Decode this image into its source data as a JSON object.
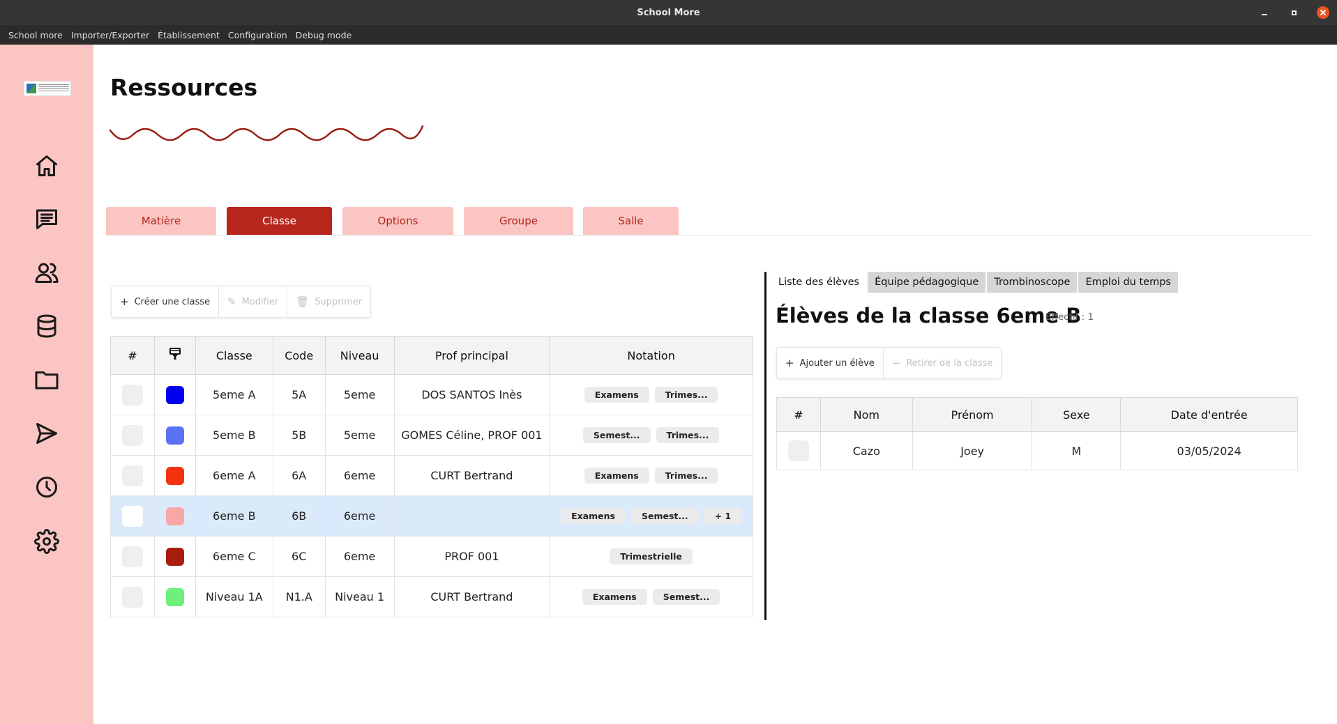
{
  "window": {
    "title": "School More"
  },
  "menu": [
    "School more",
    "Importer/Exporter",
    "Établissement",
    "Configuration",
    "Debug mode"
  ],
  "sidebar": {
    "icons": [
      "home-icon",
      "chat-icon",
      "users-icon",
      "database-icon",
      "folder-icon",
      "send-icon",
      "clock-icon",
      "gear-icon"
    ]
  },
  "page": {
    "title": "Ressources"
  },
  "tabs": [
    {
      "label": "Matière",
      "active": false
    },
    {
      "label": "Classe",
      "active": true
    },
    {
      "label": "Options",
      "active": false
    },
    {
      "label": "Groupe",
      "active": false
    },
    {
      "label": "Salle",
      "active": false
    }
  ],
  "toolbar": {
    "create": "Créer une classe",
    "edit": "Modifier",
    "delete": "Supprimer"
  },
  "class_table": {
    "headers": [
      "#",
      "",
      "Classe",
      "Code",
      "Niveau",
      "Prof principal",
      "Notation"
    ],
    "rows": [
      {
        "color": "#0000ee",
        "classe": "5eme A",
        "code": "5A",
        "niveau": "5eme",
        "prof": "DOS SANTOS Inès",
        "notation": [
          "Examens",
          "Trimes..."
        ],
        "selected": false
      },
      {
        "color": "#5b72f2",
        "classe": "5eme B",
        "code": "5B",
        "niveau": "5eme",
        "prof": "GOMES Céline, PROF 001",
        "notation": [
          "Semest...",
          "Trimes..."
        ],
        "selected": false
      },
      {
        "color": "#f2330f",
        "classe": "6eme A",
        "code": "6A",
        "niveau": "6eme",
        "prof": "CURT Bertrand",
        "notation": [
          "Examens",
          "Trimes..."
        ],
        "selected": false
      },
      {
        "color": "#f7a8a6",
        "classe": "6eme B",
        "code": "6B",
        "niveau": "6eme",
        "prof": "",
        "notation": [
          "Examens",
          "Semest...",
          "+ 1"
        ],
        "selected": true
      },
      {
        "color": "#aa1d0e",
        "classe": "6eme C",
        "code": "6C",
        "niveau": "6eme",
        "prof": "PROF 001",
        "notation": [
          "Trimestrielle"
        ],
        "selected": false
      },
      {
        "color": "#6ef07a",
        "classe": "Niveau 1A",
        "code": "N1.A",
        "niveau": "Niveau 1",
        "prof": "CURT Bertrand",
        "notation": [
          "Examens",
          "Semest..."
        ],
        "selected": false
      }
    ]
  },
  "right_panel": {
    "subtabs": [
      {
        "label": "Liste des élèves",
        "active": true
      },
      {
        "label": "Équipe pédagogique",
        "active": false
      },
      {
        "label": "Trombinoscope",
        "active": false
      },
      {
        "label": "Emploi du temps",
        "active": false
      }
    ],
    "title": "Élèves de la classe 6eme B",
    "effectif": "Effectif : 1",
    "add_label": "Ajouter un élève",
    "remove_label": "Retirer de la classe",
    "headers": [
      "#",
      "Nom",
      "Prénom",
      "Sexe",
      "Date d'entrée"
    ],
    "rows": [
      {
        "nom": "Cazo",
        "prenom": "Joey",
        "sexe": "M",
        "date": "03/05/2024"
      }
    ]
  }
}
